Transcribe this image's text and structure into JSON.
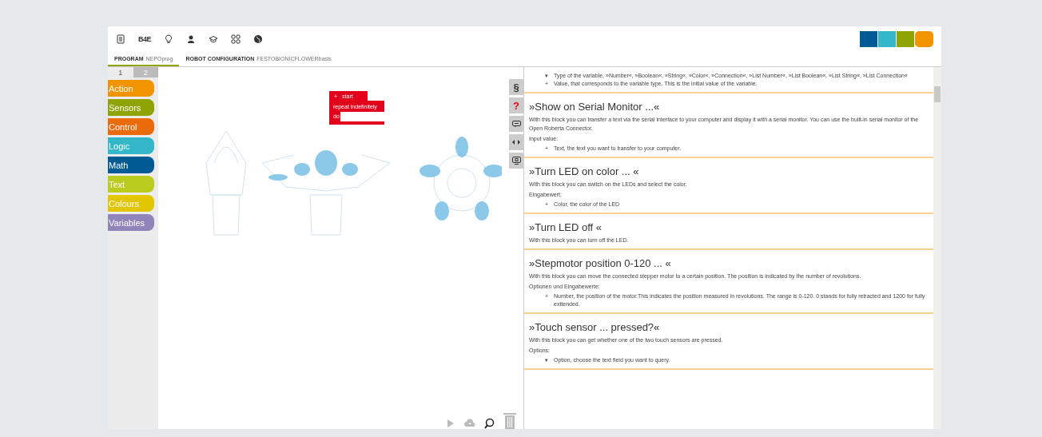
{
  "toolbar": {
    "label": "B4E"
  },
  "tabs": [
    {
      "label": "PROGRAM",
      "name": "NEPOprog",
      "selected": true
    },
    {
      "label": "ROBOT CONFIGURATION",
      "name": "FESTOBIONICFLOWERbasis",
      "selected": false
    }
  ],
  "toolbox": {
    "tabs": [
      {
        "label": "1",
        "selected": true
      },
      {
        "label": "2",
        "selected": false
      }
    ],
    "categories": [
      {
        "label": "Action",
        "color": "#f29400"
      },
      {
        "label": "Sensors",
        "color": "#8fa402"
      },
      {
        "label": "Control",
        "color": "#eb6a0a"
      },
      {
        "label": "Logic",
        "color": "#33b8ca"
      },
      {
        "label": "Math",
        "color": "#005a94"
      },
      {
        "label": "Text",
        "color": "#bacc1e"
      },
      {
        "label": "Colours",
        "color": "#e2c601"
      },
      {
        "label": "Variables",
        "color": "#9085ba"
      }
    ]
  },
  "program_block": {
    "hat": "start",
    "plus": "+",
    "statement": "repeat indefinitely",
    "slot": "do"
  },
  "side_buttons": [
    {
      "kind": "paragraph",
      "label": "§"
    },
    {
      "kind": "help",
      "label": "?"
    },
    {
      "kind": "comment"
    },
    {
      "kind": "code"
    },
    {
      "kind": "simulation"
    }
  ],
  "help": {
    "sections": [
      {
        "blocks": [
          {
            "kind": "list",
            "items": [
              {
                "marker": "▾",
                "text": "Type of the variable, »Number«, »Boolean«, »String«, »Color«, »Connection«, »List Number«, »List Boolean«, »List String«, »List Connection«"
              },
              {
                "marker": "+",
                "text": "Value, that corresponds to the variable type. This is the initial value of the variable."
              }
            ]
          }
        ]
      },
      {
        "title": "»Show on Serial Monitor ...«",
        "blocks": [
          {
            "kind": "p",
            "text": "With this block you can transfer a text via the serial interface to your computer and display it with a serial monitor. You can use the built-in serial monitor of the Open Roberta Connector."
          },
          {
            "kind": "p",
            "text": "Input value:"
          },
          {
            "kind": "list",
            "items": [
              {
                "marker": "+",
                "text": "Text, the text you want to transfer to your computer."
              }
            ]
          }
        ]
      },
      {
        "title": "»Turn LED on color ... «",
        "blocks": [
          {
            "kind": "p",
            "text": "With this block you can switch on the LEDs and select the color."
          },
          {
            "kind": "p",
            "text": "Eingabewert:"
          },
          {
            "kind": "list",
            "items": [
              {
                "marker": "+",
                "text": "Color, the color of the LED"
              }
            ]
          }
        ]
      },
      {
        "title": "»Turn LED off «",
        "blocks": [
          {
            "kind": "p",
            "text": "With this block you can turn off the LED."
          }
        ]
      },
      {
        "title": "»Stepmotor position 0-120 ... «",
        "blocks": [
          {
            "kind": "p",
            "text": "With this block you can move the connected stepper motor to a certain position. The position is indicated by the number of revolutions."
          },
          {
            "kind": "p",
            "text": "Optionen und Eingabewerte:"
          },
          {
            "kind": "list",
            "items": [
              {
                "marker": "+",
                "text": "Number, the position of the motor.This indicates the position measured in revolutions. The range is 0-120. 0 stands for fully retracted and 1200 for fully exttended."
              }
            ]
          }
        ]
      },
      {
        "title": "»Touch sensor ... pressed?«",
        "blocks": [
          {
            "kind": "p",
            "text": "With this block you can get whether one of the two touch sensors are pressed."
          },
          {
            "kind": "p",
            "text": "Options:"
          },
          {
            "kind": "list",
            "items": [
              {
                "marker": "▾",
                "text": "Option, choose the text field you want to query."
              }
            ]
          }
        ]
      }
    ]
  }
}
